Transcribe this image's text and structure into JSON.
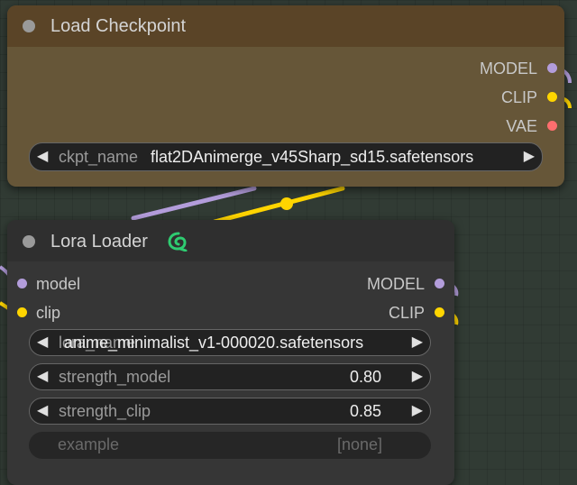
{
  "colors": {
    "model": "#b39ddb",
    "clip": "#ffd500",
    "vae": "#ff6e6e",
    "checkpoint_title_bg": "#5a4427",
    "checkpoint_body_bg": "#665638",
    "lora_title_bg": "#2f2f2f",
    "lora_body_bg": "#363636",
    "lora_badge": "#2ecc71"
  },
  "checkpoint_node": {
    "title": "Load Checkpoint",
    "outputs": [
      "MODEL",
      "CLIP",
      "VAE"
    ],
    "widget": {
      "label": "ckpt_name",
      "value": "flat2DAnimerge_v45Sharp_sd15.safetensors"
    }
  },
  "lora_node": {
    "title": "Lora Loader",
    "badge_icon": "lora-manager-icon",
    "inputs": [
      "model",
      "clip"
    ],
    "outputs": [
      "MODEL",
      "CLIP"
    ],
    "widgets": [
      {
        "label": "lora_name",
        "value": "anime_minimalist_v1-000020.safetensors"
      },
      {
        "label": "strength_model",
        "value": "0.80"
      },
      {
        "label": "strength_clip",
        "value": "0.85"
      }
    ],
    "disabled_widget": {
      "label": "example",
      "value": "[none]"
    }
  },
  "icons": {
    "left_arrow": "◀",
    "right_arrow": "▶"
  }
}
